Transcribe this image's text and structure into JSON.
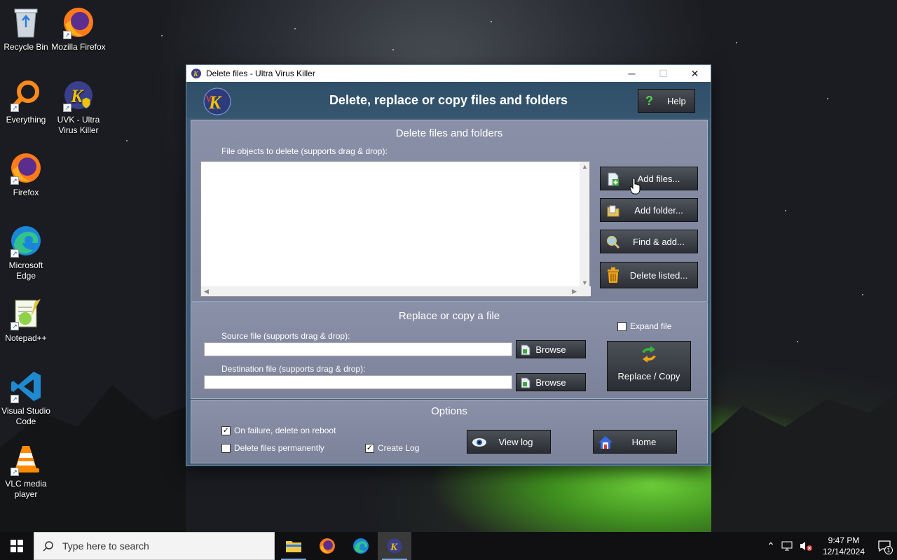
{
  "desktop": {
    "icons": [
      {
        "label": "Recycle Bin"
      },
      {
        "label": "Mozilla Firefox"
      },
      {
        "label": "Everything"
      },
      {
        "label": "UVK - Ultra Virus Killer"
      },
      {
        "label": "Firefox"
      },
      {
        "label": "Microsoft Edge"
      },
      {
        "label": "Notepad++"
      },
      {
        "label": "Visual Studio Code"
      },
      {
        "label": "VLC media player"
      }
    ]
  },
  "window": {
    "title": "Delete files - Ultra Virus Killer",
    "controls": {
      "minimize": "─",
      "maximize": "☐",
      "close": "✕"
    },
    "header": {
      "title": "Delete, replace or copy files and folders",
      "help": "Help"
    },
    "delete_section": {
      "title": "Delete files and folders",
      "list_label": "File objects to delete (supports drag & drop):",
      "buttons": {
        "add_files": "Add files...",
        "add_folder": "Add folder...",
        "find_add": "Find & add...",
        "delete_listed": "Delete listed..."
      }
    },
    "replace_section": {
      "title": "Replace or copy a file",
      "source_label": "Source file (supports drag & drop):",
      "source_value": "",
      "destination_label": "Destination file (supports drag & drop):",
      "destination_value": "",
      "browse": "Browse",
      "expand_file": "Expand file",
      "expand_file_checked": false,
      "replace_copy": "Replace / Copy"
    },
    "options_section": {
      "title": "Options",
      "on_failure": "On failure, delete on reboot",
      "on_failure_checked": true,
      "delete_permanently": "Delete files permanently",
      "delete_permanently_checked": false,
      "create_log": "Create Log",
      "create_log_checked": true,
      "view_log": "View log",
      "home": "Home"
    }
  },
  "taskbar": {
    "search_placeholder": "Type here to search",
    "time": "9:47 PM",
    "date": "12/14/2024",
    "notification_count": "1"
  }
}
